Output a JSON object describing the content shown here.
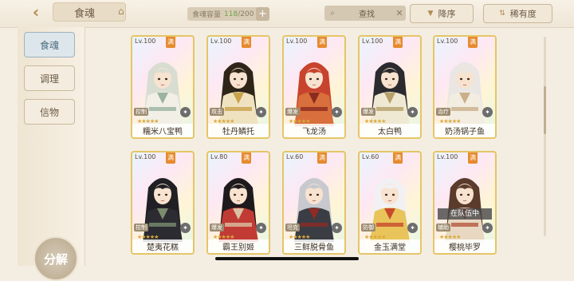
{
  "header": {
    "title": "食魂",
    "capacity_label": "食魂容量",
    "capacity_current": "118",
    "capacity_max": "/200",
    "search_text": "查找",
    "sort_desc_label": "降序",
    "sort_rarity_label": "稀有度"
  },
  "sidebar": {
    "items": [
      {
        "label": "食魂"
      },
      {
        "label": "调理"
      },
      {
        "label": "信物"
      }
    ],
    "decompose_label": "分解"
  },
  "cards": [
    {
      "level": "Lv.100",
      "full": "满",
      "tag": "控制",
      "name": "糯米八宝鸭",
      "stars": "★★★★★",
      "hair": "#d8ddd2",
      "robe": "#f1efe6",
      "accent": "#9bb3a0"
    },
    {
      "level": "Lv.100",
      "full": "满",
      "tag": "攻击",
      "name": "牡丹鳞托",
      "stars": "★★★★★",
      "hair": "#2e2418",
      "robe": "#efe2c0",
      "accent": "#c8a34a"
    },
    {
      "level": "Lv.100",
      "full": "满",
      "tag": "爆发",
      "name": "飞龙汤",
      "stars": "★★★★★",
      "hair": "#c8432d",
      "robe": "#d86f3c",
      "accent": "#8a2b1e"
    },
    {
      "level": "Lv.100",
      "full": "满",
      "tag": "爆发",
      "name": "太白鸭",
      "stars": "★★★★★",
      "hair": "#2b2a2e",
      "robe": "#efe8d2",
      "accent": "#b7a06a"
    },
    {
      "level": "Lv.100",
      "full": "满",
      "tag": "治疗",
      "name": "奶汤锅子鱼",
      "stars": "★★★★★",
      "hair": "#e9e6e3",
      "robe": "#f3ece1",
      "accent": "#c9b08a"
    },
    {
      "level": "Lv.100",
      "full": "满",
      "tag": "控制",
      "name": "楚夷花糕",
      "stars": "★★★★★",
      "hair": "#1f1f24",
      "robe": "#2b2b31",
      "accent": "#7b8c6f"
    },
    {
      "level": "Lv.80",
      "full": "满",
      "tag": "爆发",
      "name": "霸王别姬",
      "stars": "★★★★★",
      "hair": "#1e1a1c",
      "robe": "#c13b34",
      "accent": "#d9c2a3"
    },
    {
      "level": "Lv.60",
      "full": "满",
      "tag": "坦克",
      "name": "三鲜脱骨鱼",
      "stars": "★★★★★",
      "hair": "#c7c9cf",
      "robe": "#3a3d44",
      "accent": "#8f2b24"
    },
    {
      "level": "Lv.60",
      "full": "满",
      "tag": "防御",
      "name": "金玉满堂",
      "stars": "★★★★★",
      "hair": "#f1f1f4",
      "robe": "#e9c45a",
      "accent": "#c84a2d"
    },
    {
      "level": "Lv.100",
      "full": "满",
      "tag": "辅助",
      "name": "樱桃毕罗",
      "stars": "★★★★★",
      "hair": "#5b3b2c",
      "robe": "#e8d8c2",
      "accent": "#b5583f",
      "team_badge": "在队伍中"
    }
  ],
  "colors": {
    "background": "#f4eee2",
    "card_border": "#e6c566",
    "active_tab": "#dde6ea",
    "full_badge": "#e68a2e"
  },
  "icons": {
    "back": "back-arrow-icon",
    "home": "home-icon",
    "search": "search-icon",
    "clear": "close-icon",
    "sort_desc": "sort-down-icon",
    "sort_rarity": "sort-updown-icon",
    "lock": "lock-icon"
  }
}
